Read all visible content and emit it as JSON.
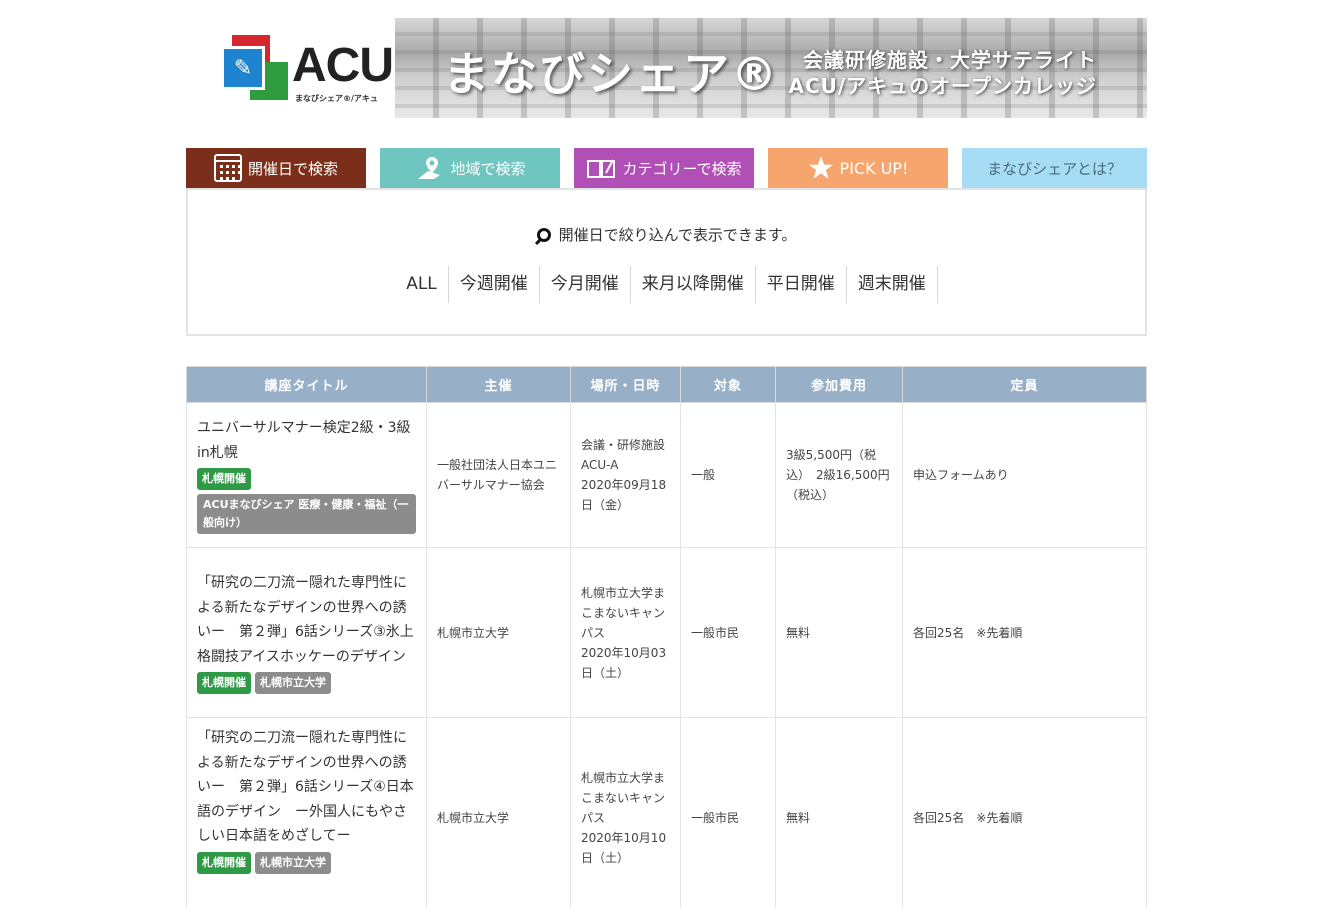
{
  "banner": {
    "logo_text": "ACU",
    "logo_sub": "まなびシェア®/アキュ",
    "title": "まなびシェア®",
    "subtitle_line1": "会議研修施設・大学サテライト",
    "subtitle_line2": "ACU/アキュのオープンカレッジ"
  },
  "tabs": [
    {
      "label": "開催日で検索",
      "color": "#7b2f1a",
      "icon": "calendar-icon"
    },
    {
      "label": "地域で検索",
      "color": "#6fc5c0",
      "icon": "map-pin-icon"
    },
    {
      "label": "カテゴリーで検索",
      "color": "#b04fb5",
      "icon": "book-icon"
    },
    {
      "label": "PICK UP!",
      "color": "#f6a56f",
      "icon": "star-icon"
    },
    {
      "label": "まなびシェアとは？",
      "color": "#a7dcf5"
    }
  ],
  "filter": {
    "hint": "開催日で絞り込んで表示できます。",
    "links": [
      "ALL",
      "今週開催",
      "今月開催",
      "来月以降開催",
      "平日開催",
      "週末開催"
    ]
  },
  "table": {
    "headers": [
      "講座タイトル",
      "主催",
      "場所・日時",
      "対象",
      "参加費用",
      "定員"
    ],
    "rows": [
      {
        "title": "ユニバーサルマナー検定2級・3級 in札幌",
        "badges": [
          "札幌開催",
          "ACUまなびシェア 医療・健康・福祉（一般向け）"
        ],
        "host": "一般社団法人日本ユニバーサルマナー協会",
        "place": "会議・研修施設ACU-A",
        "date": "2020年09月18日（金）",
        "target": "一般",
        "fee": "3級5,500円（税込）　2級16,500円（税込）",
        "capacity": "申込フォームあり"
      },
      {
        "title": "「研究の二刀流ー隠れた専門性による新たなデザインの世界への誘いー　第２弾」6話シリーズ③氷上格闘技アイスホッケーのデザイン",
        "badges": [
          "札幌開催",
          "札幌市立大学"
        ],
        "host": "札幌市立大学",
        "place": "札幌市立大学まこまないキャンパス",
        "date": "2020年10月03日（土）",
        "target": "一般市民",
        "fee": "無料",
        "capacity": "各回25名　※先着順"
      },
      {
        "title": "「研究の二刀流ー隠れた専門性による新たなデザインの世界への誘いー　第２弾」6話シリーズ④日本語のデザイン　ー外国人にもやさしい日本語をめざしてー",
        "badges": [
          "札幌開催",
          "札幌市立大学"
        ],
        "host": "札幌市立大学",
        "place": "札幌市立大学まこまないキャンパス",
        "date": "2020年10月10日（土）",
        "target": "一般市民",
        "fee": "無料",
        "capacity": "各回25名　※先着順"
      }
    ]
  }
}
